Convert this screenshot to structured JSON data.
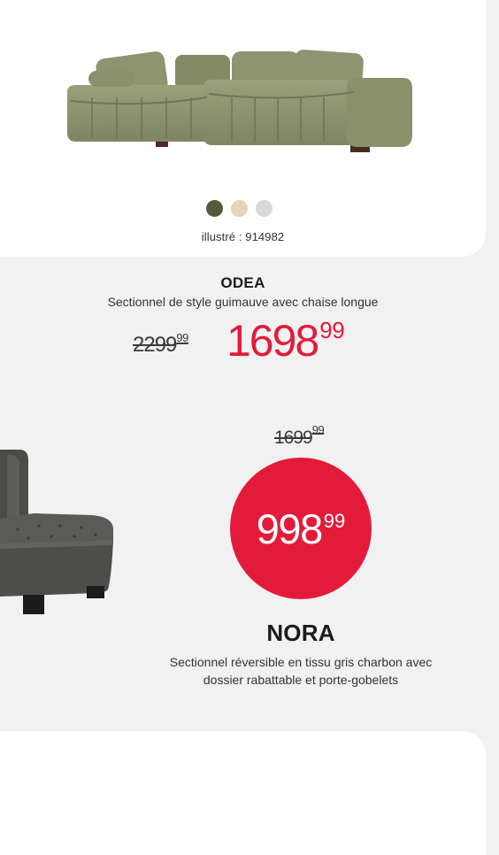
{
  "product1": {
    "swatch_colors": [
      "#555a3a",
      "#e2d5b8",
      "#d8d8d8"
    ],
    "caption": "illustré : 914982",
    "name": "ODEA",
    "description": "Sectionnel de style guimauve avec chaise longue",
    "old_price": {
      "main": "2299",
      "cents": "99"
    },
    "new_price": {
      "main": "1698",
      "cents": "99"
    },
    "sofa_color": "#8f9571"
  },
  "product2": {
    "old_price": {
      "main": "1699",
      "cents": "99"
    },
    "sale_price": {
      "main": "998",
      "cents": "99"
    },
    "name": "NORA",
    "description": "Sectionnel réversible en tissu gris charbon avec dossier rabattable et porte-gobelets",
    "fabric_color": "#545550"
  },
  "accent_color": "#e31b3a"
}
